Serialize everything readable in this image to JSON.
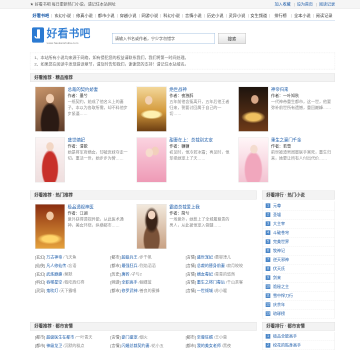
{
  "top_bar": {
    "notice": "★ 好看书吧 每日更新热门小说，请记住本站网址",
    "links": [
      "加入收藏",
      "设为首页",
      "阅读记录"
    ]
  },
  "nav": [
    "好看书吧",
    "玄幻小说",
    "修真小说",
    "都市小说",
    "穿越小说",
    "网游小说",
    "科幻小说",
    "言情小说",
    "历史小说",
    "灵异小说",
    "女生频道",
    "排行榜",
    "全本小说",
    "阅读记录"
  ],
  "logo": {
    "name": "好看书吧",
    "url": "www.haokanshuba.com"
  },
  "search": {
    "placeholder": "请输入书名或作者，宁少字勿错字",
    "button": "搜索"
  },
  "notices": [
    "1、本站所有小说均来源于网络，如有侵犯您的权益请联系我们，我们将第一时间处理。",
    "2、如果您在阅读中发现错误章节，请及时告知我们，谢谢您的支持！请记住本站域名。"
  ],
  "featured": {
    "title": "好看推荐 · 精品推荐",
    "books": [
      {
        "title": "总裁的契约娇妻",
        "author": "作者：墨兮",
        "desc": "一纸契约，她成了他名义上的妻子。本以为各取所需，却不料他步步紧逼……"
      },
      {
        "title": "绝世战神",
        "author": "作者：夜独醉",
        "desc": "五年前他含冤离开，五年后他王者归来，誓要讨回属于自己的一切……"
      },
      {
        "title": "神帝归来",
        "author": "作者：一叶知秋",
        "desc": "一代神帝重生都市，这一世，他要弥补前世所有遗憾，重回巅峰……"
      },
      {
        "title": "盛世嫡妃",
        "author": "作者：清歌",
        "desc": "她是将军府嫡女，却被庶妹夺走一切。重活一世，她步步为营……"
      },
      {
        "title": "甜妻在上：总裁别太宠",
        "author": "作者：糖糖",
        "desc": "初见时，他冷若冰霜；再见时，他却把她宠上了天……"
      },
      {
        "title": "重生之豪门千金",
        "author": "作者：若雪",
        "desc": "前世被渣男闺蜜联手害死，重生归来，她要让所有人付出代价……"
      }
    ]
  },
  "hot": {
    "title": "好看推荐 · 热门推荐",
    "books": [
      {
        "title": "极品透视神医",
        "author": "作者：江湖",
        "desc": "意外获得透视异能，从此医术通神，美女环绕，纵横都市……"
      },
      {
        "title": "霸道总裁爱上我",
        "author": "作者：简兮",
        "desc": "一场意外，她惹上了全城最尊贵的男人，从此被他宠入骨髓……"
      }
    ],
    "list": [
      {
        "cat": "[玄幻]",
        "title": "万古神帝",
        "author": "/飞天鱼"
      },
      {
        "cat": "[都市]",
        "title": "超级兵王",
        "author": "/步千帆"
      },
      {
        "cat": "[言情]",
        "title": "盛世宠妃",
        "author": "/慕容湮儿"
      },
      {
        "cat": "[仙侠]",
        "title": "凡人修仙传",
        "author": "/忘语"
      },
      {
        "cat": "[都市]",
        "title": "最强狂兵",
        "author": "/烈焰滔滔"
      },
      {
        "cat": "[言情]",
        "title": "总裁的替身前妻",
        "author": "/寂月皎皎"
      },
      {
        "cat": "[玄幻]",
        "title": "武炼巅峰",
        "author": "/莫默"
      },
      {
        "cat": "[历史]",
        "title": "唐砖",
        "author": "/孑与2"
      },
      {
        "cat": "[言情]",
        "title": "嫡女毒妃",
        "author": "/青青的悠然"
      },
      {
        "cat": "[科幻]",
        "title": "吞噬星空",
        "author": "/我吃西红柿"
      },
      {
        "cat": "[网游]",
        "title": "全职高手",
        "author": "/蝴蝶蓝"
      },
      {
        "cat": "[言情]",
        "title": "重生之将门毒后",
        "author": "/千山茶客"
      },
      {
        "cat": "[灵异]",
        "title": "鬼吹灯",
        "author": "/天下霸唱"
      },
      {
        "cat": "[都市]",
        "title": "修罗武神",
        "author": "/善良的蜜蜂"
      },
      {
        "cat": "[言情]",
        "title": "一世倾城",
        "author": "/苏小暖"
      }
    ]
  },
  "rank": {
    "title": "好看排行 · 热门小说",
    "items": [
      {
        "no": "1",
        "title": "元尊"
      },
      {
        "no": "2",
        "title": "圣墟"
      },
      {
        "no": "3",
        "title": "大主宰"
      },
      {
        "no": "4",
        "title": "斗破苍穹"
      },
      {
        "no": "5",
        "title": "完美世界"
      },
      {
        "no": "6",
        "title": "牧神记"
      },
      {
        "no": "7",
        "title": "逆天邪神"
      },
      {
        "no": "8",
        "title": "伏天氏"
      },
      {
        "no": "9",
        "title": "剑来"
      },
      {
        "no": "10",
        "title": "诡秘之主"
      },
      {
        "no": "11",
        "title": "雪中悍刀行"
      },
      {
        "no": "12",
        "title": "庆余年"
      },
      {
        "no": "13",
        "title": "琅琊榜"
      }
    ]
  },
  "urban": {
    "title": "好看推荐 · 都市言情",
    "list": [
      {
        "cat": "[都市]",
        "title": "超级医生在都市",
        "author": "/一叶青天"
      },
      {
        "cat": "[言情]",
        "title": "豪门盛宠",
        "author": "/烟火"
      },
      {
        "cat": "[都市]",
        "title": "至尊狂婿",
        "author": "/王小蛮"
      },
      {
        "cat": "[都市]",
        "title": "神级龙卫",
        "author": "/沉默的糕点"
      },
      {
        "cat": "[言情]",
        "title": "闪婚总裁契约妻",
        "author": "/花小五"
      },
      {
        "cat": "[都市]",
        "title": "我的美女老师",
        "author": "/黑夜"
      }
    ]
  },
  "urban_rank": {
    "title": "好看排行 · 都市言情",
    "items": [
      {
        "no": "1",
        "title": "极品全能高手"
      },
      {
        "no": "2",
        "title": "校花的贴身高手"
      }
    ]
  },
  "colors": {
    "link": "#1a5aa8",
    "accent": "#2b7ad2",
    "badge": "#4a86c8"
  }
}
